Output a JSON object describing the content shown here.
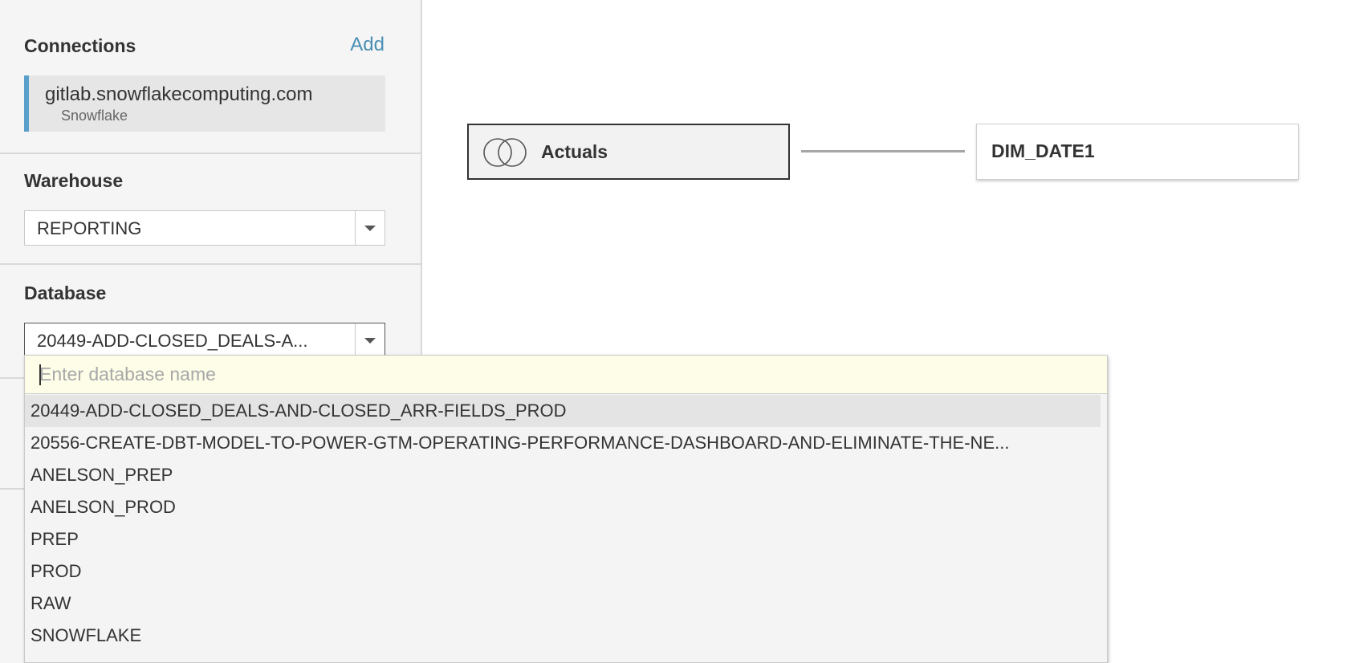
{
  "sidebar": {
    "connections": {
      "title": "Connections",
      "add_label": "Add",
      "items": [
        {
          "name": "gitlab.snowflakecomputing.com",
          "type": "Snowflake"
        }
      ]
    },
    "warehouse": {
      "title": "Warehouse",
      "value": "REPORTING"
    },
    "database": {
      "title": "Database",
      "value": "20449-ADD-CLOSED_DEALS-A..."
    }
  },
  "canvas": {
    "tables": [
      {
        "label": "Actuals",
        "icon": "union-icon"
      },
      {
        "label": "DIM_DATE1"
      }
    ]
  },
  "dropdown": {
    "placeholder": "Enter database name",
    "options": [
      "20449-ADD-CLOSED_DEALS-AND-CLOSED_ARR-FIELDS_PROD",
      "20556-CREATE-DBT-MODEL-TO-POWER-GTM-OPERATING-PERFORMANCE-DASHBOARD-AND-ELIMINATE-THE-NE...",
      "ANELSON_PREP",
      "ANELSON_PROD",
      "PREP",
      "PROD",
      "RAW",
      "SNOWFLAKE"
    ],
    "selected_index": 0,
    "partial_option": "...",
    "colors": {
      "search_bg": "#fdfde8",
      "selected_bg": "#e4e4e4",
      "accent": "#4a8fb5"
    }
  }
}
